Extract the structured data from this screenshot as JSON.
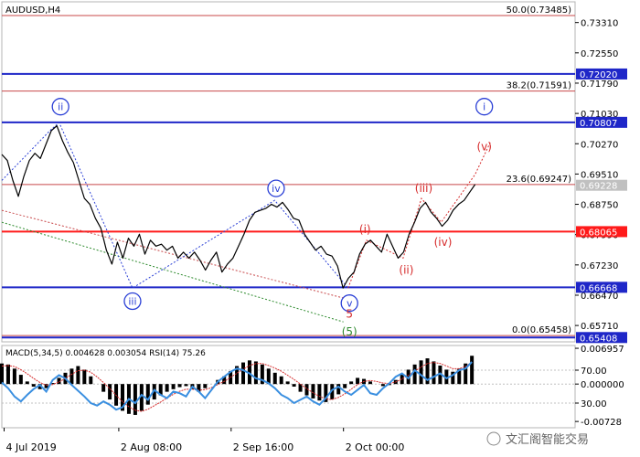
{
  "chart_data": [
    {
      "type": "line",
      "title": "AUDUSD,H4",
      "ylim": [
        0.653,
        0.7383
      ],
      "xlim": [
        0,
        100
      ],
      "price_ticks": [
        "0.73310",
        "0.72550",
        "0.71790",
        "0.71030",
        "0.70270",
        "0.69510",
        "0.68750",
        "0.67990",
        "0.67230",
        "0.66470",
        "0.65710"
      ],
      "date_ticks": [
        {
          "label": "4 Jul 2019",
          "x": 0.5
        },
        {
          "label": "2 Aug 08:00",
          "x": 25.5
        },
        {
          "label": "2 Sep 16:00",
          "x": 50
        },
        {
          "label": "2 Oct 00:00",
          "x": 74.5
        }
      ],
      "levels": [
        {
          "text": "50.0(0.73485)",
          "price": 0.73485,
          "color": "#c8484a",
          "label_box": false
        },
        {
          "text": "0.72020",
          "price": 0.7202,
          "color": "#1f27c8",
          "label_box": true,
          "box_color": "#1f27c8"
        },
        {
          "text": "38.2(0.71591)",
          "price": 0.71591,
          "color": "#c8484a",
          "label_box": false
        },
        {
          "text": "0.70807",
          "price": 0.70807,
          "color": "#1f27c8",
          "label_box": true,
          "box_color": "#1f27c8"
        },
        {
          "text": "23.6(0.69247)",
          "price": 0.69247,
          "color": "#c8484a",
          "label_box": false
        },
        {
          "text": "0.68065",
          "price": 0.68065,
          "color": "#ff1a1a",
          "label_box": true,
          "box_color": "#ff1a1a"
        },
        {
          "text": "0.66668",
          "price": 0.66668,
          "color": "#1f27c8",
          "label_box": true,
          "box_color": "#1f27c8"
        },
        {
          "text": "0.0(0.65458)",
          "price": 0.65458,
          "color": "#c8484a",
          "label_box": false
        },
        {
          "text": "0.65408",
          "price": 0.65408,
          "color": "#1f27c8",
          "label_box": true,
          "box_color": "#1f27c8"
        }
      ],
      "current_price": {
        "text": "0.69228",
        "price": 0.69228
      },
      "series": [
        {
          "points": [
            [
              0,
              0.7
            ],
            [
              1.2,
              0.6985
            ],
            [
              2.4,
              0.6935
            ],
            [
              3.6,
              0.6895
            ],
            [
              4.8,
              0.6945
            ],
            [
              6,
              0.6985
            ],
            [
              7.2,
              0.7003
            ],
            [
              8.4,
              0.699
            ],
            [
              9.6,
              0.7025
            ],
            [
              10.8,
              0.706
            ],
            [
              12,
              0.7072
            ],
            [
              13.2,
              0.7035
            ],
            [
              14.4,
              0.7005
            ],
            [
              15.6,
              0.698
            ],
            [
              16.8,
              0.6935
            ],
            [
              18,
              0.689
            ],
            [
              19.2,
              0.6875
            ],
            [
              20.4,
              0.684
            ],
            [
              21.6,
              0.6815
            ],
            [
              22.8,
              0.676
            ],
            [
              24,
              0.6725
            ],
            [
              25.2,
              0.678
            ],
            [
              26.4,
              0.674
            ],
            [
              27.6,
              0.679
            ],
            [
              28.8,
              0.677
            ],
            [
              30,
              0.68
            ],
            [
              31.2,
              0.675
            ],
            [
              32.4,
              0.6785
            ],
            [
              33.6,
              0.677
            ],
            [
              34.8,
              0.6775
            ],
            [
              36,
              0.676
            ],
            [
              37.2,
              0.677
            ],
            [
              38.4,
              0.674
            ],
            [
              39.6,
              0.6755
            ],
            [
              40.8,
              0.674
            ],
            [
              42,
              0.6755
            ],
            [
              43.2,
              0.6735
            ],
            [
              44.4,
              0.671
            ],
            [
              45.6,
              0.6735
            ],
            [
              46.8,
              0.6755
            ],
            [
              48,
              0.6705
            ],
            [
              49.2,
              0.6725
            ],
            [
              50.4,
              0.674
            ],
            [
              51.6,
              0.677
            ],
            [
              52.8,
              0.68
            ],
            [
              54,
              0.6835
            ],
            [
              55.2,
              0.6855
            ],
            [
              56.4,
              0.686
            ],
            [
              57.6,
              0.6865
            ],
            [
              58.8,
              0.6875
            ],
            [
              60,
              0.6868
            ],
            [
              61.2,
              0.688
            ],
            [
              62.4,
              0.6862
            ],
            [
              63.6,
              0.684
            ],
            [
              64.8,
              0.6835
            ],
            [
              66,
              0.68
            ],
            [
              67.2,
              0.678
            ],
            [
              68.4,
              0.676
            ],
            [
              69.6,
              0.677
            ],
            [
              70.8,
              0.675
            ],
            [
              72,
              0.6745
            ],
            [
              73.2,
              0.672
            ],
            [
              74.4,
              0.6665
            ],
            [
              75.6,
              0.669
            ],
            [
              76.8,
              0.6705
            ],
            [
              78,
              0.675
            ],
            [
              79.2,
              0.6775
            ],
            [
              80.4,
              0.6785
            ],
            [
              81.6,
              0.677
            ],
            [
              82.8,
              0.6755
            ],
            [
              84,
              0.68
            ],
            [
              85.2,
              0.677
            ],
            [
              86.4,
              0.674
            ],
            [
              87.6,
              0.6755
            ],
            [
              88.8,
              0.68
            ],
            [
              90,
              0.683
            ],
            [
              91.2,
              0.6865
            ],
            [
              92.4,
              0.688
            ],
            [
              93.6,
              0.6855
            ],
            [
              94.8,
              0.684
            ],
            [
              96,
              0.682
            ],
            [
              97.2,
              0.6835
            ],
            [
              98.4,
              0.686
            ],
            [
              99.6,
              0.6875
            ],
            [
              100.8,
              0.6885
            ],
            [
              102,
              0.6905
            ],
            [
              103.2,
              0.6925
            ]
          ]
        }
      ],
      "wave_labels": [
        {
          "text": "ii",
          "x": 12.8,
          "price": 0.712,
          "style": "circle-blue"
        },
        {
          "text": "iii",
          "x": 28.5,
          "price": 0.6632,
          "style": "circle-blue"
        },
        {
          "text": "iv",
          "x": 59.8,
          "price": 0.6915,
          "style": "circle-blue"
        },
        {
          "text": "v",
          "x": 75.8,
          "price": 0.6627,
          "style": "circle-blue"
        },
        {
          "text": "5",
          "x": 75.8,
          "price": 0.66,
          "style": "red"
        },
        {
          "text": "(5)",
          "x": 75.8,
          "price": 0.6555,
          "style": "green"
        },
        {
          "text": "(i)",
          "x": 79.2,
          "price": 0.6812,
          "style": "red"
        },
        {
          "text": "(ii)",
          "x": 88.2,
          "price": 0.671,
          "style": "red"
        },
        {
          "text": "(iii)",
          "x": 92.0,
          "price": 0.6915,
          "style": "red"
        },
        {
          "text": "(iv)",
          "x": 96.2,
          "price": 0.678,
          "style": "red"
        },
        {
          "text": "(v)",
          "x": 105.2,
          "price": 0.702,
          "style": "red"
        },
        {
          "text": "i",
          "x": 105.2,
          "price": 0.712,
          "style": "circle-blue"
        }
      ],
      "wave_lines": [
        {
          "color": "#2a3fd6",
          "dash": "2,2",
          "points": [
            [
              0,
              0.6935
            ],
            [
              10.5,
              0.706
            ],
            [
              12.5,
              0.708
            ],
            [
              28.5,
              0.6665
            ],
            [
              59.5,
              0.6885
            ],
            [
              75.5,
              0.6665
            ]
          ]
        },
        {
          "color": "#d62a2a",
          "dash": "2,2",
          "points": [
            [
              75.5,
              0.6665
            ],
            [
              79.5,
              0.6785
            ],
            [
              87.5,
              0.674
            ],
            [
              91.5,
              0.689
            ],
            [
              95.8,
              0.683
            ],
            [
              103.2,
              0.695
            ],
            [
              106.5,
              0.703
            ]
          ]
        }
      ],
      "trend_lines": [
        {
          "color": "#c8484a",
          "dash": "2,2",
          "from": [
            0,
            0.686
          ],
          "to": [
            74.5,
            0.664
          ]
        },
        {
          "color": "#2e8b2e",
          "dash": "2,2",
          "from": [
            0,
            0.683
          ],
          "to": [
            74.5,
            0.658
          ]
        }
      ]
    },
    {
      "type": "line",
      "title": "MACD(5,34,5) 0.004628 0.003054 RSI(14) 75.26",
      "ylim": [
        -0.0085,
        0.0075
      ],
      "ticks": [
        "0.006957",
        "70.00",
        "0.000000",
        "30.00",
        "-0.00728"
      ],
      "series": [
        {
          "name": "MACD",
          "color": "#000000",
          "values": [
            0.004,
            0.0038,
            0.003,
            0.0018,
            0.0005,
            -0.0005,
            -0.001,
            -0.0008,
            0.0002,
            0.0012,
            0.0022,
            0.003,
            0.0035,
            0.0028,
            0.0015,
            0.0,
            -0.0015,
            -0.003,
            -0.0042,
            -0.0052,
            -0.0058,
            -0.006,
            -0.0052,
            -0.004,
            -0.003,
            -0.0022,
            -0.0015,
            -0.001,
            -0.0006,
            -0.0004,
            -0.001,
            -0.0015,
            -0.0008,
            0.0,
            0.0008,
            0.0015,
            0.0025,
            0.0035,
            0.0042,
            0.0046,
            0.0044,
            0.0038,
            0.003,
            0.0022,
            0.0015,
            0.0005,
            -0.0005,
            -0.0015,
            -0.0022,
            -0.0028,
            -0.0032,
            -0.0035,
            -0.003,
            -0.002,
            -0.0008,
            0.0005,
            0.0012,
            0.001,
            0.0005,
            0.0,
            -0.0004,
            -0.0002,
            0.0008,
            0.0018,
            0.0028,
            0.0038,
            0.0046,
            0.005,
            0.0044,
            0.0036,
            0.0028,
            0.0024,
            0.003,
            0.004,
            0.0055
          ]
        },
        {
          "name": "Signal",
          "color": "#d62a2a",
          "values": [
            0.0035,
            0.0036,
            0.0034,
            0.0028,
            0.002,
            0.0011,
            0.0003,
            -0.0002,
            -0.0001,
            0.0004,
            0.0011,
            0.0019,
            0.0026,
            0.0027,
            0.0023,
            0.0014,
            0.0003,
            -0.0009,
            -0.0022,
            -0.0034,
            -0.0044,
            -0.0051,
            -0.0053,
            -0.0049,
            -0.0042,
            -0.0035,
            -0.0027,
            -0.002,
            -0.0014,
            -0.001,
            -0.001,
            -0.0012,
            -0.0011,
            -0.0007,
            -0.0001,
            0.0005,
            0.0013,
            0.0021,
            0.0029,
            0.0036,
            0.004,
            0.004,
            0.0036,
            0.0031,
            0.0025,
            0.0017,
            0.0009,
            0.0,
            -0.0009,
            -0.0017,
            -0.0024,
            -0.0029,
            -0.003,
            -0.0026,
            -0.0019,
            -0.001,
            -0.0001,
            0.0005,
            0.0007,
            0.0005,
            0.0002,
            0.0001,
            0.0004,
            0.001,
            0.0017,
            0.0025,
            0.0033,
            0.004,
            0.0042,
            0.004,
            0.0035,
            0.003,
            0.003,
            0.0034,
            0.0043
          ]
        },
        {
          "name": "RSI",
          "color": "#3a8fe0",
          "values": [
            55,
            48,
            38,
            32,
            40,
            47,
            52,
            44,
            58,
            64,
            60,
            52,
            45,
            38,
            30,
            27,
            32,
            28,
            22,
            25,
            35,
            30,
            40,
            34,
            46,
            40,
            36,
            44,
            42,
            38,
            50,
            44,
            36,
            46,
            56,
            62,
            68,
            72,
            70,
            66,
            60,
            58,
            54,
            48,
            40,
            36,
            30,
            34,
            38,
            32,
            28,
            36,
            46,
            50,
            44,
            40,
            46,
            52,
            42,
            40,
            48,
            54,
            62,
            66,
            60,
            70,
            64,
            58,
            62,
            66,
            60,
            64,
            70,
            72,
            80
          ]
        }
      ]
    }
  ],
  "watermark": {
    "text": "文汇阁智能交易"
  }
}
